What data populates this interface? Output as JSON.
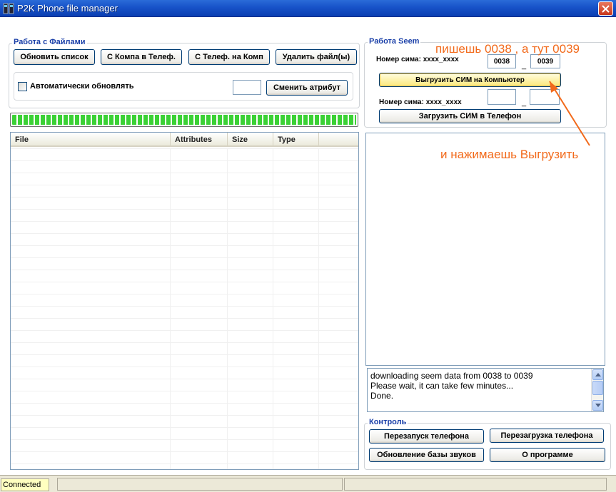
{
  "window": {
    "title": "P2K Phone file manager"
  },
  "files_group": {
    "title": "Работа с Файлами",
    "buttons": {
      "refresh": "Обновить список",
      "pc_to_phone": "С Компа в Телеф.",
      "phone_to_pc": "С Телеф. на Комп",
      "delete": "Удалить файл(ы)"
    },
    "auto_update_label": "Автоматически обновлять",
    "auto_update_checked": false,
    "attribute_value": "",
    "change_attr_button": "Сменить атрибут"
  },
  "progress": {
    "fraction": 1.0
  },
  "file_list": {
    "columns": [
      "File",
      "Attributes",
      "Size",
      "Type"
    ],
    "rows": []
  },
  "seem_group": {
    "title": "Работа  Seem",
    "seem_number_label": "Номер сима: xxxx_xxxx",
    "seem_from": "0038",
    "seem_to": "0039",
    "separator": "_",
    "download_button": "Выгрузить СИМ на Компьютер",
    "seem_number_label_2": "Номер сима: xxxx_xxxx",
    "seem_from_2": "",
    "seem_to_2": "",
    "upload_button": "Загрузить СИМ в Телефон"
  },
  "log": {
    "lines": [
      "downloading seem data from 0038 to 0039",
      "Please wait, it can take few minutes...",
      "Done."
    ]
  },
  "control_group": {
    "title": "Контроль",
    "buttons": {
      "restart": "Перезапуск телефона",
      "reboot": "Перезагрузка телефона",
      "sounds": "Обновление базы звуков",
      "about": "О программе"
    }
  },
  "statusbar": {
    "status": "Connected"
  },
  "annotations": {
    "top": "пишешь 0038  , а тут 0039",
    "side": "и нажимаешь Выгрузить"
  },
  "colors": {
    "annotation": "#f26a1b",
    "title_bar": "#1752c8",
    "group_title": "#1a3fa8",
    "progress": "#3bd135",
    "status_highlight": "#ffffc0"
  }
}
